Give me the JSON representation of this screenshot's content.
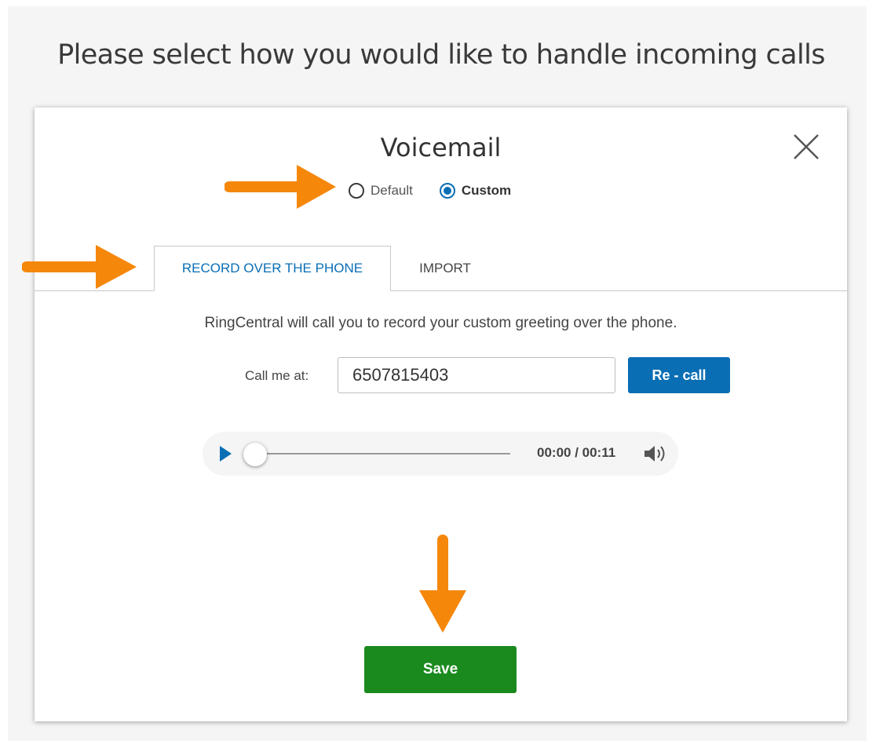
{
  "page": {
    "prompt": "Please select how you would like to handle incoming calls"
  },
  "dialog": {
    "title": "Voicemail",
    "close_icon": "close-icon",
    "greeting_options": [
      {
        "label": "Default",
        "selected": false
      },
      {
        "label": "Custom",
        "selected": true
      }
    ],
    "tabs": [
      {
        "label": "RECORD OVER THE PHONE",
        "active": true
      },
      {
        "label": "IMPORT",
        "active": false
      }
    ],
    "info_text": "RingCentral will call you to record your custom greeting over the phone.",
    "call_me_label": "Call me at:",
    "phone_number": "6507815403",
    "recall_label": "Re - call",
    "player": {
      "time_display": "00:00 / 00:11",
      "progress": 0,
      "play_icon": "play-icon",
      "volume_icon": "volume-icon"
    },
    "save_label": "Save"
  },
  "colors": {
    "accent": "#0a6eb4",
    "save": "#1a8a1e",
    "annotation_arrow": "#f5870b"
  }
}
